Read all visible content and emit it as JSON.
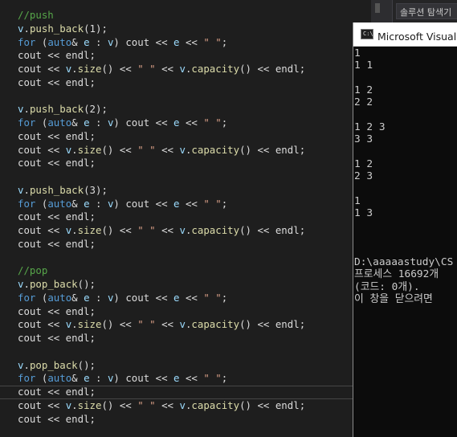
{
  "code_lines": [
    [
      {
        "c": "tk-comment",
        "t": "//push"
      }
    ],
    [
      {
        "c": "tk-var",
        "t": "v"
      },
      {
        "c": "tk-plain",
        "t": "."
      },
      {
        "c": "tk-func",
        "t": "push_back"
      },
      {
        "c": "tk-plain",
        "t": "(1);"
      }
    ],
    [
      {
        "c": "tk-keyword",
        "t": "for"
      },
      {
        "c": "tk-plain",
        "t": " ("
      },
      {
        "c": "tk-keyword",
        "t": "auto"
      },
      {
        "c": "tk-plain",
        "t": "& "
      },
      {
        "c": "tk-var",
        "t": "e"
      },
      {
        "c": "tk-plain",
        "t": " : "
      },
      {
        "c": "tk-var",
        "t": "v"
      },
      {
        "c": "tk-plain",
        "t": ") cout << "
      },
      {
        "c": "tk-var",
        "t": "e"
      },
      {
        "c": "tk-plain",
        "t": " << "
      },
      {
        "c": "tk-string",
        "t": "\" \""
      },
      {
        "c": "tk-plain",
        "t": ";"
      }
    ],
    [
      {
        "c": "tk-plain",
        "t": "cout << endl;"
      }
    ],
    [
      {
        "c": "tk-plain",
        "t": "cout << "
      },
      {
        "c": "tk-var",
        "t": "v"
      },
      {
        "c": "tk-plain",
        "t": "."
      },
      {
        "c": "tk-func",
        "t": "size"
      },
      {
        "c": "tk-plain",
        "t": "() << "
      },
      {
        "c": "tk-string",
        "t": "\" \""
      },
      {
        "c": "tk-plain",
        "t": " << "
      },
      {
        "c": "tk-var",
        "t": "v"
      },
      {
        "c": "tk-plain",
        "t": "."
      },
      {
        "c": "tk-func",
        "t": "capacity"
      },
      {
        "c": "tk-plain",
        "t": "() << endl;"
      }
    ],
    [
      {
        "c": "tk-plain",
        "t": "cout << endl;"
      }
    ],
    [],
    [
      {
        "c": "tk-var",
        "t": "v"
      },
      {
        "c": "tk-plain",
        "t": "."
      },
      {
        "c": "tk-func",
        "t": "push_back"
      },
      {
        "c": "tk-plain",
        "t": "(2);"
      }
    ],
    [
      {
        "c": "tk-keyword",
        "t": "for"
      },
      {
        "c": "tk-plain",
        "t": " ("
      },
      {
        "c": "tk-keyword",
        "t": "auto"
      },
      {
        "c": "tk-plain",
        "t": "& "
      },
      {
        "c": "tk-var",
        "t": "e"
      },
      {
        "c": "tk-plain",
        "t": " : "
      },
      {
        "c": "tk-var",
        "t": "v"
      },
      {
        "c": "tk-plain",
        "t": ") cout << "
      },
      {
        "c": "tk-var",
        "t": "e"
      },
      {
        "c": "tk-plain",
        "t": " << "
      },
      {
        "c": "tk-string",
        "t": "\" \""
      },
      {
        "c": "tk-plain",
        "t": ";"
      }
    ],
    [
      {
        "c": "tk-plain",
        "t": "cout << endl;"
      }
    ],
    [
      {
        "c": "tk-plain",
        "t": "cout << "
      },
      {
        "c": "tk-var",
        "t": "v"
      },
      {
        "c": "tk-plain",
        "t": "."
      },
      {
        "c": "tk-func",
        "t": "size"
      },
      {
        "c": "tk-plain",
        "t": "() << "
      },
      {
        "c": "tk-string",
        "t": "\" \""
      },
      {
        "c": "tk-plain",
        "t": " << "
      },
      {
        "c": "tk-var",
        "t": "v"
      },
      {
        "c": "tk-plain",
        "t": "."
      },
      {
        "c": "tk-func",
        "t": "capacity"
      },
      {
        "c": "tk-plain",
        "t": "() << endl;"
      }
    ],
    [
      {
        "c": "tk-plain",
        "t": "cout << endl;"
      }
    ],
    [],
    [
      {
        "c": "tk-var",
        "t": "v"
      },
      {
        "c": "tk-plain",
        "t": "."
      },
      {
        "c": "tk-func",
        "t": "push_back"
      },
      {
        "c": "tk-plain",
        "t": "(3);"
      }
    ],
    [
      {
        "c": "tk-keyword",
        "t": "for"
      },
      {
        "c": "tk-plain",
        "t": " ("
      },
      {
        "c": "tk-keyword",
        "t": "auto"
      },
      {
        "c": "tk-plain",
        "t": "& "
      },
      {
        "c": "tk-var",
        "t": "e"
      },
      {
        "c": "tk-plain",
        "t": " : "
      },
      {
        "c": "tk-var",
        "t": "v"
      },
      {
        "c": "tk-plain",
        "t": ") cout << "
      },
      {
        "c": "tk-var",
        "t": "e"
      },
      {
        "c": "tk-plain",
        "t": " << "
      },
      {
        "c": "tk-string",
        "t": "\" \""
      },
      {
        "c": "tk-plain",
        "t": ";"
      }
    ],
    [
      {
        "c": "tk-plain",
        "t": "cout << endl;"
      }
    ],
    [
      {
        "c": "tk-plain",
        "t": "cout << "
      },
      {
        "c": "tk-var",
        "t": "v"
      },
      {
        "c": "tk-plain",
        "t": "."
      },
      {
        "c": "tk-func",
        "t": "size"
      },
      {
        "c": "tk-plain",
        "t": "() << "
      },
      {
        "c": "tk-string",
        "t": "\" \""
      },
      {
        "c": "tk-plain",
        "t": " << "
      },
      {
        "c": "tk-var",
        "t": "v"
      },
      {
        "c": "tk-plain",
        "t": "."
      },
      {
        "c": "tk-func",
        "t": "capacity"
      },
      {
        "c": "tk-plain",
        "t": "() << endl;"
      }
    ],
    [
      {
        "c": "tk-plain",
        "t": "cout << endl;"
      }
    ],
    [],
    [
      {
        "c": "tk-comment",
        "t": "//pop"
      }
    ],
    [
      {
        "c": "tk-var",
        "t": "v"
      },
      {
        "c": "tk-plain",
        "t": "."
      },
      {
        "c": "tk-func",
        "t": "pop_back"
      },
      {
        "c": "tk-plain",
        "t": "();"
      }
    ],
    [
      {
        "c": "tk-keyword",
        "t": "for"
      },
      {
        "c": "tk-plain",
        "t": " ("
      },
      {
        "c": "tk-keyword",
        "t": "auto"
      },
      {
        "c": "tk-plain",
        "t": "& "
      },
      {
        "c": "tk-var",
        "t": "e"
      },
      {
        "c": "tk-plain",
        "t": " : "
      },
      {
        "c": "tk-var",
        "t": "v"
      },
      {
        "c": "tk-plain",
        "t": ") cout << "
      },
      {
        "c": "tk-var",
        "t": "e"
      },
      {
        "c": "tk-plain",
        "t": " << "
      },
      {
        "c": "tk-string",
        "t": "\" \""
      },
      {
        "c": "tk-plain",
        "t": ";"
      }
    ],
    [
      {
        "c": "tk-plain",
        "t": "cout << endl;"
      }
    ],
    [
      {
        "c": "tk-plain",
        "t": "cout << "
      },
      {
        "c": "tk-var",
        "t": "v"
      },
      {
        "c": "tk-plain",
        "t": "."
      },
      {
        "c": "tk-func",
        "t": "size"
      },
      {
        "c": "tk-plain",
        "t": "() << "
      },
      {
        "c": "tk-string",
        "t": "\" \""
      },
      {
        "c": "tk-plain",
        "t": " << "
      },
      {
        "c": "tk-var",
        "t": "v"
      },
      {
        "c": "tk-plain",
        "t": "."
      },
      {
        "c": "tk-func",
        "t": "capacity"
      },
      {
        "c": "tk-plain",
        "t": "() << endl;"
      }
    ],
    [
      {
        "c": "tk-plain",
        "t": "cout << endl;"
      }
    ],
    [],
    [
      {
        "c": "tk-var",
        "t": "v"
      },
      {
        "c": "tk-plain",
        "t": "."
      },
      {
        "c": "tk-func",
        "t": "pop_back"
      },
      {
        "c": "tk-plain",
        "t": "();"
      }
    ],
    [
      {
        "c": "tk-keyword",
        "t": "for"
      },
      {
        "c": "tk-plain",
        "t": " ("
      },
      {
        "c": "tk-keyword",
        "t": "auto"
      },
      {
        "c": "tk-plain",
        "t": "& "
      },
      {
        "c": "tk-var",
        "t": "e"
      },
      {
        "c": "tk-plain",
        "t": " : "
      },
      {
        "c": "tk-var",
        "t": "v"
      },
      {
        "c": "tk-plain",
        "t": ") cout << "
      },
      {
        "c": "tk-var",
        "t": "e"
      },
      {
        "c": "tk-plain",
        "t": " << "
      },
      {
        "c": "tk-string",
        "t": "\" \""
      },
      {
        "c": "tk-plain",
        "t": ";"
      }
    ],
    [
      {
        "c": "tk-plain",
        "t": "cout << endl;"
      }
    ],
    [
      {
        "c": "tk-plain",
        "t": "cout << "
      },
      {
        "c": "tk-var",
        "t": "v"
      },
      {
        "c": "tk-plain",
        "t": "."
      },
      {
        "c": "tk-func",
        "t": "size"
      },
      {
        "c": "tk-plain",
        "t": "() << "
      },
      {
        "c": "tk-string",
        "t": "\" \""
      },
      {
        "c": "tk-plain",
        "t": " << "
      },
      {
        "c": "tk-var",
        "t": "v"
      },
      {
        "c": "tk-plain",
        "t": "."
      },
      {
        "c": "tk-func",
        "t": "capacity"
      },
      {
        "c": "tk-plain",
        "t": "() << endl;"
      }
    ],
    [
      {
        "c": "tk-plain",
        "t": "cout << endl;"
      }
    ]
  ],
  "solution_explorer": {
    "search_placeholder": "솔루션 탐색기"
  },
  "console": {
    "icon_label": "C:\\",
    "title": "Microsoft Visual Studio 디버그 콘솔",
    "lines": [
      "1",
      "1 1",
      "",
      "1 2",
      "2 2",
      "",
      "1 2 3",
      "3 3",
      "",
      "1 2",
      "2 3",
      "",
      "1",
      "1 3",
      "",
      "",
      "",
      "D:\\aaaaastudy\\CS",
      "프로세스 16692개",
      "(코드: 0개).",
      "이 창을 닫으려면"
    ]
  },
  "colors": {
    "editor_bg": "#1e1e1e",
    "comment": "#57a64a",
    "keyword": "#569cd6",
    "variable": "#9cdcfe",
    "function": "#dcdcaa",
    "string": "#d69d85",
    "console_bg": "#0c0c0c"
  }
}
